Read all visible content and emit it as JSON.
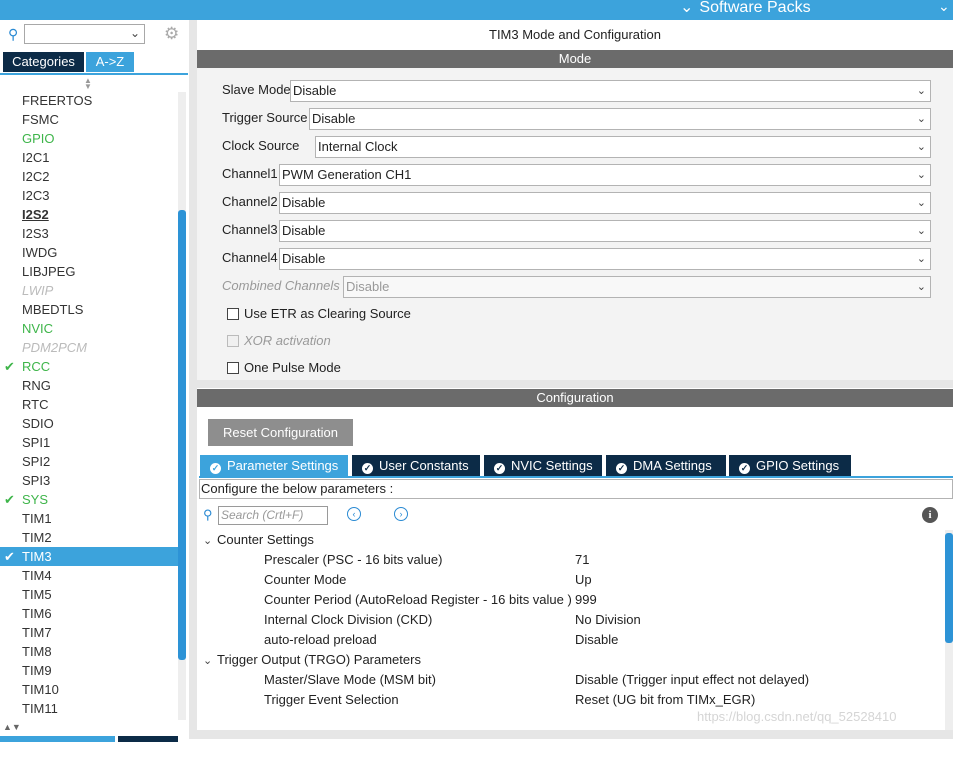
{
  "topbar": {
    "software_packs": "Software Packs"
  },
  "left": {
    "search_value": "",
    "tabs": {
      "categories": "Categories",
      "az": "A->Z"
    },
    "items": [
      {
        "label": "FREERTOS",
        "style": "normal"
      },
      {
        "label": "FSMC",
        "style": "normal"
      },
      {
        "label": "GPIO",
        "style": "green"
      },
      {
        "label": "I2C1",
        "style": "normal"
      },
      {
        "label": "I2C2",
        "style": "normal"
      },
      {
        "label": "I2C3",
        "style": "normal"
      },
      {
        "label": "I2S2",
        "style": "bold"
      },
      {
        "label": "I2S3",
        "style": "normal"
      },
      {
        "label": "IWDG",
        "style": "normal"
      },
      {
        "label": "LIBJPEG",
        "style": "normal"
      },
      {
        "label": "LWIP",
        "style": "disabled"
      },
      {
        "label": "MBEDTLS",
        "style": "normal"
      },
      {
        "label": "NVIC",
        "style": "green"
      },
      {
        "label": "PDM2PCM",
        "style": "disabled"
      },
      {
        "label": "RCC",
        "style": "green-check"
      },
      {
        "label": "RNG",
        "style": "normal"
      },
      {
        "label": "RTC",
        "style": "normal"
      },
      {
        "label": "SDIO",
        "style": "normal"
      },
      {
        "label": "SPI1",
        "style": "normal"
      },
      {
        "label": "SPI2",
        "style": "normal"
      },
      {
        "label": "SPI3",
        "style": "normal"
      },
      {
        "label": "SYS",
        "style": "green-check"
      },
      {
        "label": "TIM1",
        "style": "normal"
      },
      {
        "label": "TIM2",
        "style": "normal"
      },
      {
        "label": "TIM3",
        "style": "selected"
      },
      {
        "label": "TIM4",
        "style": "normal"
      },
      {
        "label": "TIM5",
        "style": "normal"
      },
      {
        "label": "TIM6",
        "style": "normal"
      },
      {
        "label": "TIM7",
        "style": "normal"
      },
      {
        "label": "TIM8",
        "style": "normal"
      },
      {
        "label": "TIM9",
        "style": "normal"
      },
      {
        "label": "TIM10",
        "style": "normal"
      },
      {
        "label": "TIM11",
        "style": "normal"
      }
    ]
  },
  "right": {
    "title": "TIM3 Mode and Configuration",
    "mode_header": "Mode",
    "config_header": "Configuration",
    "fields": {
      "slave_mode": {
        "label": "Slave Mode",
        "value": "Disable"
      },
      "trigger_source": {
        "label": "Trigger Source",
        "value": "Disable"
      },
      "clock_source": {
        "label": "Clock Source",
        "value": "Internal Clock"
      },
      "channel1": {
        "label": "Channel1",
        "value": "PWM Generation CH1"
      },
      "channel2": {
        "label": "Channel2",
        "value": "Disable"
      },
      "channel3": {
        "label": "Channel3",
        "value": "Disable"
      },
      "channel4": {
        "label": "Channel4",
        "value": "Disable"
      },
      "combined": {
        "label": "Combined Channels",
        "value": "Disable"
      }
    },
    "checkboxes": {
      "etr": "Use ETR as Clearing Source",
      "xor": "XOR activation",
      "one_pulse": "One Pulse Mode"
    },
    "reset_button": "Reset Configuration",
    "tabs": {
      "parameter": "Parameter Settings",
      "user_constants": "User Constants",
      "nvic": "NVIC Settings",
      "dma": "DMA Settings",
      "gpio": "GPIO Settings"
    },
    "configure_label": "Configure the below parameters :",
    "param_search_placeholder": "Search (Crtl+F)",
    "groups": {
      "counter": "Counter Settings",
      "trgo": "Trigger Output (TRGO) Parameters"
    },
    "params": {
      "prescaler": {
        "name": "Prescaler (PSC - 16 bits value)",
        "value": "71"
      },
      "counter_mode": {
        "name": "Counter Mode",
        "value": "Up"
      },
      "counter_period": {
        "name": "Counter Period (AutoReload Register - 16 bits value )",
        "value": "999"
      },
      "ckd": {
        "name": "Internal Clock Division (CKD)",
        "value": "No Division"
      },
      "arp": {
        "name": "auto-reload preload",
        "value": "Disable"
      },
      "msm": {
        "name": "Master/Slave Mode (MSM bit)",
        "value": "Disable (Trigger input effect not delayed)"
      },
      "trgo_sel": {
        "name": "Trigger Event Selection",
        "value": "Reset (UG bit from TIMx_EGR)"
      }
    }
  },
  "watermark": "https://blog.csdn.net/qq_52528410"
}
